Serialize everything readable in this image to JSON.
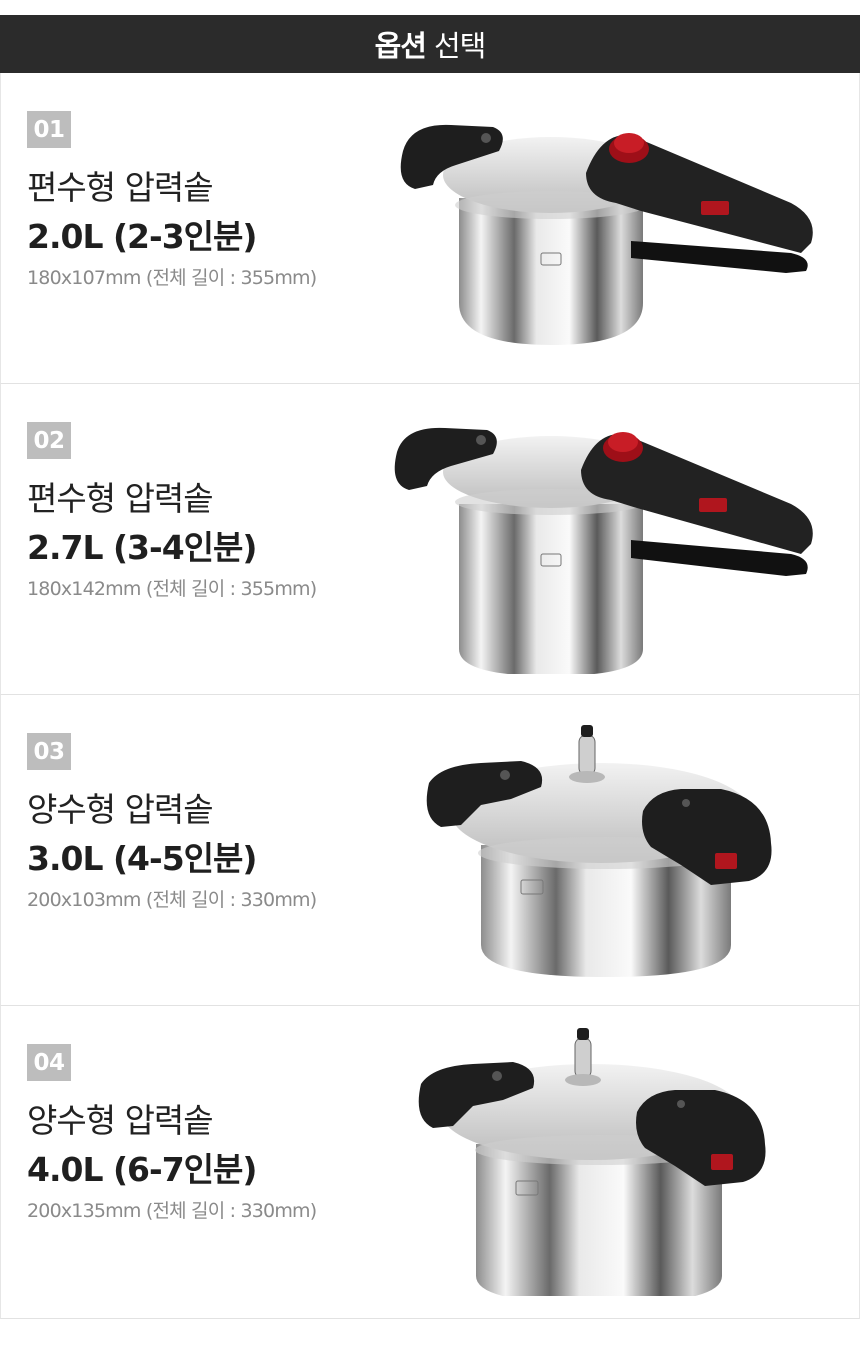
{
  "header": {
    "bold": "옵션",
    "light": "선택"
  },
  "options": [
    {
      "num": "01",
      "type": "편수형 압력솥",
      "capacity": "2.0L (2-3인분)",
      "dims": "180x107mm (전체 길이 : 355mm)",
      "image": "single-handle-pressure-cooker"
    },
    {
      "num": "02",
      "type": "편수형 압력솥",
      "capacity": "2.7L (3-4인분)",
      "dims": "180x142mm (전체 길이 : 355mm)",
      "image": "single-handle-pressure-cooker-tall"
    },
    {
      "num": "03",
      "type": "양수형 압력솥",
      "capacity": "3.0L (4-5인분)",
      "dims": "200x103mm (전체 길이 : 330mm)",
      "image": "double-handle-pressure-cooker"
    },
    {
      "num": "04",
      "type": "양수형 압력솥",
      "capacity": "4.0L (6-7인분)",
      "dims": "200x135mm (전체 길이 : 330mm)",
      "image": "double-handle-pressure-cooker-tall"
    }
  ],
  "colors": {
    "header_bg": "#2b2b2b",
    "badge_bg": "#bdbdbd",
    "handle": "#1e1e1e",
    "valve_red": "#b0161e",
    "steel": "#d9d9d9"
  }
}
